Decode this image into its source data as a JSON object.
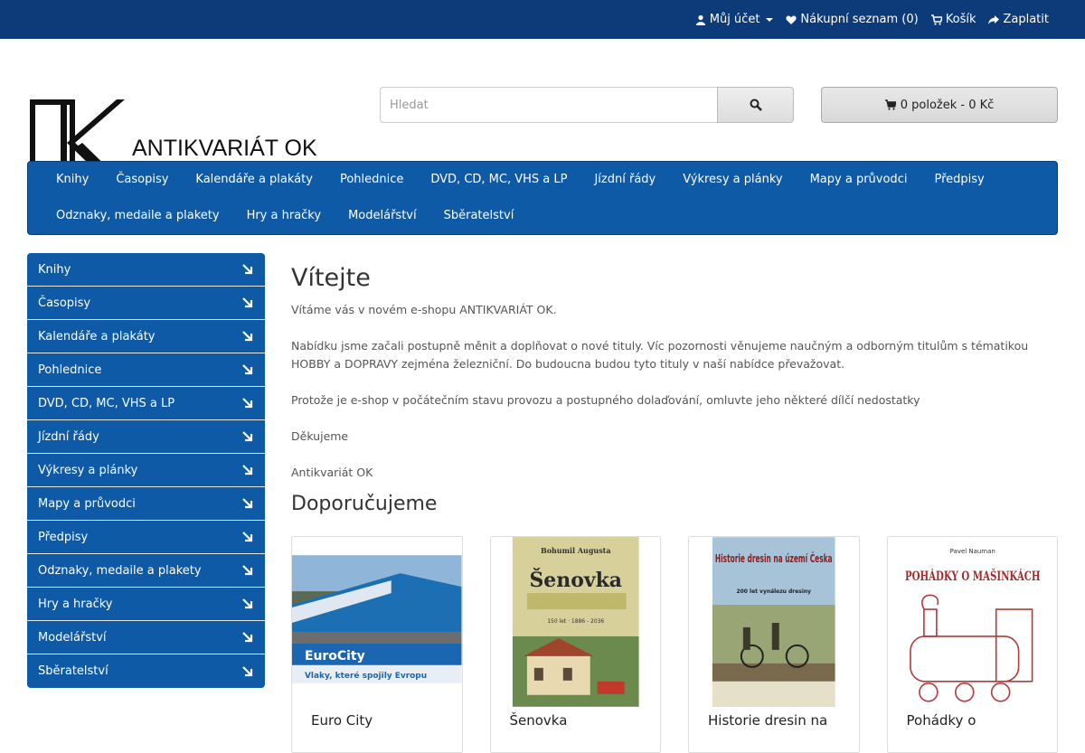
{
  "topbar": {
    "account": "Můj účet",
    "wishlist": "Nákupní seznam (0)",
    "cart": "Košík",
    "checkout": "Zaplatit"
  },
  "logo": {
    "text": "ANTIKVARIÁT OK"
  },
  "search": {
    "placeholder": "Hledat"
  },
  "cart_button": {
    "label": "0 položek - 0 Kč"
  },
  "main_nav": [
    "Knihy",
    "Časopisy",
    "Kalendáře a plakáty",
    "Pohlednice",
    "DVD, CD, MC, VHS a LP",
    "Jízdní řády",
    "Výkresy a plánky",
    "Mapy a průvodci",
    "Předpisy",
    "Odznaky, medaile a plakety",
    "Hry a hračky",
    "Modelářství",
    "Sběratelství"
  ],
  "sidebar": [
    "Knihy",
    "Časopisy",
    "Kalendáře a plakáty",
    "Pohlednice",
    "DVD, CD, MC, VHS a LP",
    "Jízdní řády",
    "Výkresy a plánky",
    "Mapy a průvodci",
    "Předpisy",
    "Odznaky, medaile a plakety",
    "Hry a hračky",
    "Modelářství",
    "Sběratelství"
  ],
  "content": {
    "title": "Vítejte",
    "p1": "Vítáme vás v novém e-shopu ANTIKVARIÁT OK.",
    "p2": "Nabídku jsme začali postupně měnit a doplňovat o nové tituly. Víc pozornosti věnujeme naučným a odborným  titulům s tématikou HOBBY a DOPRAVY zejména železniční. Do budoucna budou tyto tituly v naší nabídce převažovat.",
    "p3": "Protože je e-shop v počátečním stavu provozu a postupného dolaďování, omluvte jeho některé dílčí nedostatky",
    "p4": "Děkujeme",
    "p5": "Antikvariát OK",
    "recommended": "Doporučujeme"
  },
  "products": [
    {
      "name": "Euro City",
      "cover_title": "EuroCity",
      "cover_sub": "Vlaky, které spojily Evropu"
    },
    {
      "name": "Šenovka",
      "cover_title": "Šenovka",
      "cover_author": "Bohumil Augusta",
      "cover_years": "150 let · 1886 - 2036"
    },
    {
      "name": "Historie dresin na",
      "cover_title": "Historie dresin na území Česka",
      "cover_sub": "200 let vynálezu dresiny"
    },
    {
      "name": "Pohádky o",
      "cover_title": "POHÁDKY O MAŠINKÁCH",
      "cover_author": "Pavel Nauman"
    }
  ],
  "colors": {
    "topbar": "#0d3b7a",
    "nav": "#0e5aa7"
  }
}
